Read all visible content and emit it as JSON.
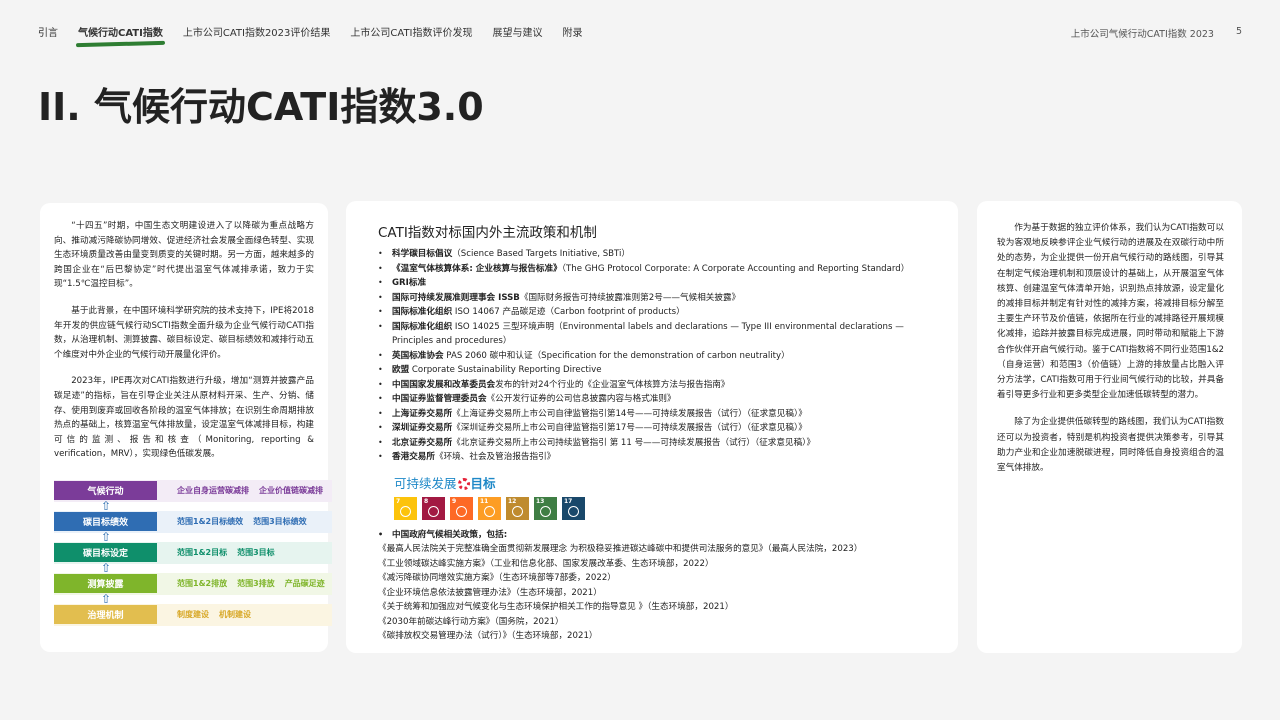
{
  "nav": {
    "items": [
      "引言",
      "气候行动CATI指数",
      "上市公司CATI指数2023评价结果",
      "上市公司CATI指数评价发现",
      "展望与建议",
      "附录"
    ],
    "active_index": 1
  },
  "header": {
    "report_title": "上市公司气候行动CATI指数 2023",
    "page_number": "5"
  },
  "page_title": "II. 气候行动CATI指数3.0",
  "left_card": {
    "paragraphs": [
      "“十四五”时期，中国生态文明建设进入了以降碳为重点战略方向、推动减污降碳协同增效、促进经济社会发展全面绿色转型、实现生态环境质量改善由量变到质变的关键时期。另一方面，越来越多的跨国企业在“后巴黎协定”时代提出温室气体减排承诺，致力于实现“1.5℃温控目标”。",
      "基于此背景，在中国环境科学研究院的技术支持下，IPE将2018年开发的供应链气候行动SCTI指数全面升级为企业气候行动CATI指数，从治理机制、测算披露、碳目标设定、碳目标绩效和减排行动五个维度对中外企业的气候行动开展量化评价。",
      "2023年，IPE再次对CATI指数进行升级，增加“测算并披露产品碳足迹”的指标，旨在引导企业关注从原材料开采、生产、分销、储存、使用到废弃或回收各阶段的温室气体排放；在识别生命周期排放热点的基础上，核算温室气体排放量，设定温室气体减排目标，构建可信的监测、报告和核查（Monitoring, reporting & verification，MRV），实现绿色低碳发展。"
    ],
    "framework": [
      {
        "label": "气候行动",
        "color": "#7b3c99",
        "desc_color": "#7b3c99",
        "bg": "#f3ecf6",
        "desc": [
          "企业自身运营碳减排",
          "企业价值链碳减排"
        ]
      },
      {
        "label": "碳目标绩效",
        "color": "#2f6db3",
        "desc_color": "#2f6db3",
        "bg": "#eaf1f9",
        "desc": [
          "范围1&2目标绩效",
          "范围3目标绩效"
        ]
      },
      {
        "label": "碳目标设定",
        "color": "#0f8f6b",
        "desc_color": "#0f8f6b",
        "bg": "#e6f4ef",
        "desc": [
          "范围1&2目标",
          "范围3目标"
        ]
      },
      {
        "label": "测算披露",
        "color": "#7fb52b",
        "desc_color": "#7fb52b",
        "bg": "#f1f7e6",
        "desc": [
          "范围1&2排放",
          "范围3排放",
          "产品碳足迹"
        ]
      },
      {
        "label": "治理机制",
        "color": "#e2be4f",
        "desc_color": "#d8a92a",
        "bg": "#fbf5e2",
        "desc": [
          "制度建设",
          "机制建设"
        ]
      }
    ]
  },
  "mid_card": {
    "title": "CATI指数对标国内外主流政策和机制",
    "items": [
      {
        "bold": "科学碳目标倡议",
        "text": "（Science Based Targets Initiative, SBTi）"
      },
      {
        "bold": "《温室气体核算体系: 企业核算与报告标准》",
        "text": "（The GHG Protocol Corporate: A Corporate Accounting and Reporting Standard）"
      },
      {
        "bold": "GRI标准",
        "text": ""
      },
      {
        "bold": "国际可持续发展准则理事会 ISSB",
        "text": "《国际财务报告可持续披露准则第2号——气候相关披露》"
      },
      {
        "bold": "国际标准化组织",
        "text": " ISO 14067 产品碳足迹（Carbon footprint of products）"
      },
      {
        "bold": "国际标准化组织",
        "text": " ISO 14025 三型环境声明（Environmental labels and declarations — Type III environmental declarations — Principles and procedures）"
      },
      {
        "bold": "英国标准协会",
        "text": " PAS 2060 碳中和认证（Specification for the demonstration of carbon neutrality）"
      },
      {
        "bold": "欧盟",
        "text": " Corporate Sustainability Reporting Directive"
      },
      {
        "bold": "中国国家发展和改革委员会",
        "text": "发布的针对24个行业的《企业温室气体核算方法与报告指南》"
      },
      {
        "bold": "中国证券监督管理委员会",
        "text": "《公开发行证券的公司信息披露内容与格式准则》"
      },
      {
        "bold": "上海证券交易所",
        "text": "《上海证券交易所上市公司自律监管指引第14号——可持续发展报告（试行）（征求意见稿）》"
      },
      {
        "bold": "深圳证券交易所",
        "text": "《深圳证券交易所上市公司自律监管指引第17号——可持续发展报告（试行）（征求意见稿）》"
      },
      {
        "bold": "北京证券交易所",
        "text": "《北京证券交易所上市公司持续监管指引 第 11 号——可持续发展报告（试行）（征求意见稿）》"
      },
      {
        "bold": "香港交易所",
        "text": "《环境、社会及管治报告指引》"
      }
    ],
    "sdg_title_a": "可持续发展",
    "sdg_title_b": "目标",
    "sdg_icons": [
      {
        "num": "7",
        "color": "#fcc30b"
      },
      {
        "num": "8",
        "color": "#a21942"
      },
      {
        "num": "9",
        "color": "#fd6925"
      },
      {
        "num": "11",
        "color": "#fd9d24"
      },
      {
        "num": "12",
        "color": "#bf8b2e"
      },
      {
        "num": "13",
        "color": "#3f7e44"
      },
      {
        "num": "17",
        "color": "#19486a"
      }
    ],
    "gov_heading": "中国政府气候相关政策，包括:",
    "gov_items": [
      "《最高人民法院关于完整准确全面贯彻新发展理念 为积极稳妥推进碳达峰碳中和提供司法服务的意见》（最高人民法院，2023）",
      "《工业领域碳达峰实施方案》（工业和信息化部、国家发展改革委、生态环境部，2022）",
      "《减污降碳协同增效实施方案》（生态环境部等7部委，2022）",
      "《企业环境信息依法披露管理办法》（生态环境部，2021）",
      "《关于统筹和加强应对气候变化与生态环境保护相关工作的指导意见 》（生态环境部，2021）",
      "《2030年前碳达峰行动方案》（国务院，2021）",
      "《碳排放权交易管理办法（试行）》（生态环境部，2021）"
    ]
  },
  "right_card": {
    "paragraphs": [
      "作为基于数据的独立评价体系，我们认为CATI指数可以较为客观地反映参评企业气候行动的进展及在双碳行动中所处的态势，为企业提供一份开启气候行动的路线图，引导其在制定气候治理机制和顶层设计的基础上，从开展温室气体核算、创建温室气体清单开始，识别热点排放源，设定量化的减排目标并制定有针对性的减排方案，将减排目标分解至主要生产环节及价值链，依据所在行业的减排路径开展规模化减排，追踪并披露目标完成进展，同时带动和赋能上下游合作伙伴开启气候行动。鉴于CATI指数将不同行业范围1&2（自身运营）和范围3（价值链）上游的排放量占比融入评分方法学，CATI指数可用于行业间气候行动的比较，并具备着引导更多行业和更多类型企业加速低碳转型的潜力。",
      "除了为企业提供低碳转型的路线图，我们认为CATI指数还可以为投资者，特别是机构投资者提供决策参考，引导其助力产业和企业加速脱碳进程，同时降低自身投资组合的温室气体排放。"
    ]
  }
}
